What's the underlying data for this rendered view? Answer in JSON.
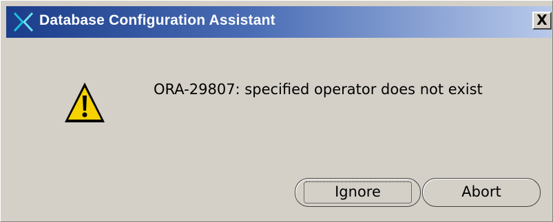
{
  "window": {
    "title": "Database Configuration Assistant",
    "close_label": "X",
    "icon": "oracle-x-icon"
  },
  "dialog": {
    "icon": "warning-icon",
    "message": "ORA-29807: specified operator does not exist"
  },
  "buttons": {
    "ignore_label": "Ignore",
    "abort_label": "Abort"
  },
  "colors": {
    "titlebar_start": "#1b3d8a",
    "titlebar_end": "#b8c9ea",
    "dialog_background": "#d4d0c8",
    "warning_yellow": "#f5d200"
  }
}
